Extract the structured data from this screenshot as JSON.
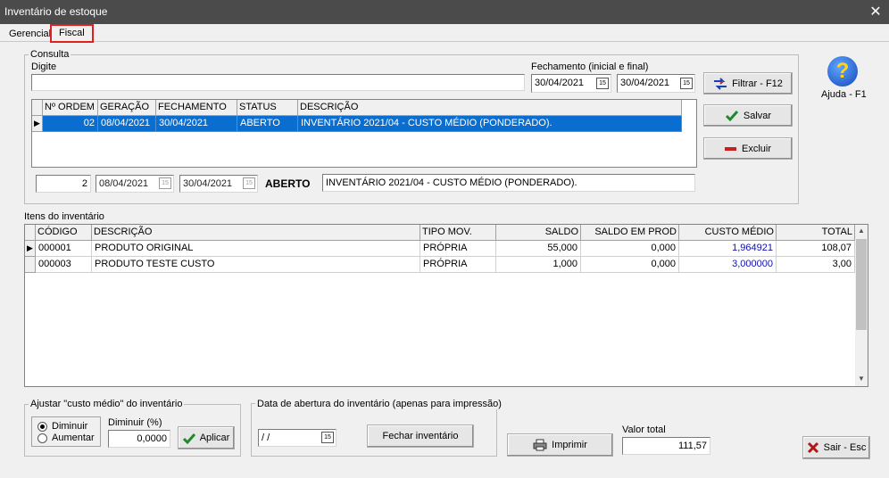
{
  "window": {
    "title": "Inventário de estoque",
    "close_glyph": "✕"
  },
  "tabs": [
    {
      "label": "Gerencial"
    },
    {
      "label": "Fiscal"
    }
  ],
  "consulta": {
    "group_title": "Consulta",
    "digite_label": "Digite",
    "digite_value": "",
    "fechamento_label": "Fechamento (inicial e final)",
    "date_start": "30/04/2021",
    "date_end": "30/04/2021",
    "grid": {
      "headers": [
        "Nº ORDEM",
        "GERAÇÃO",
        "FECHAMENTO",
        "STATUS",
        "DESCRIÇÃO"
      ],
      "rows": [
        {
          "ordem": "02",
          "geracao": "08/04/2021",
          "fechamento": "30/04/2021",
          "status": "ABERTO",
          "descricao": "INVENTÁRIO 2021/04 - CUSTO MÉDIO (PONDERADO)."
        }
      ]
    },
    "detail": {
      "ordem": "2",
      "geracao": "08/04/2021",
      "fechamento": "30/04/2021",
      "status": "ABERTO",
      "descricao": "INVENTÁRIO 2021/04 - CUSTO MÉDIO (PONDERADO)."
    }
  },
  "buttons": {
    "filtrar": "Filtrar - F12",
    "salvar": "Salvar",
    "excluir": "Excluir",
    "ajuda": "Ajuda - F1",
    "imprimir": "Imprimir",
    "sair": "Sair - Esc",
    "aplicar": "Aplicar",
    "fechar_inventario": "Fechar inventário"
  },
  "itens": {
    "section_label": "Itens do inventário",
    "headers": [
      "CÓDIGO",
      "DESCRIÇÃO",
      "TIPO MOV.",
      "SALDO",
      "SALDO EM PROD",
      "CUSTO MÉDIO",
      "TOTAL"
    ],
    "rows": [
      {
        "codigo": "000001",
        "descricao": "PRODUTO ORIGINAL",
        "tipo": "PRÓPRIA",
        "saldo": "55,000",
        "saldo_prod": "0,000",
        "custo": "1,964921",
        "total": "108,07"
      },
      {
        "codigo": "000003",
        "descricao": "PRODUTO TESTE CUSTO",
        "tipo": "PRÓPRIA",
        "saldo": "1,000",
        "saldo_prod": "0,000",
        "custo": "3,000000",
        "total": "3,00"
      }
    ]
  },
  "ajustar": {
    "title": "Ajustar \"custo médio\" do inventário",
    "option_diminuir": "Diminuir",
    "option_aumentar": "Aumentar",
    "field_label": "Diminuir (%)",
    "field_value": "0,0000"
  },
  "abertura": {
    "title": "Data de abertura do inventário (apenas para impressão)",
    "date_value": " / /"
  },
  "valor_total": {
    "label": "Valor total",
    "value": "111,57"
  },
  "colors": {
    "selection": "#0a6ed1",
    "title_bar": "#4b4b4b",
    "accent_red": "#e02020",
    "value_blue": "#1010b0"
  }
}
